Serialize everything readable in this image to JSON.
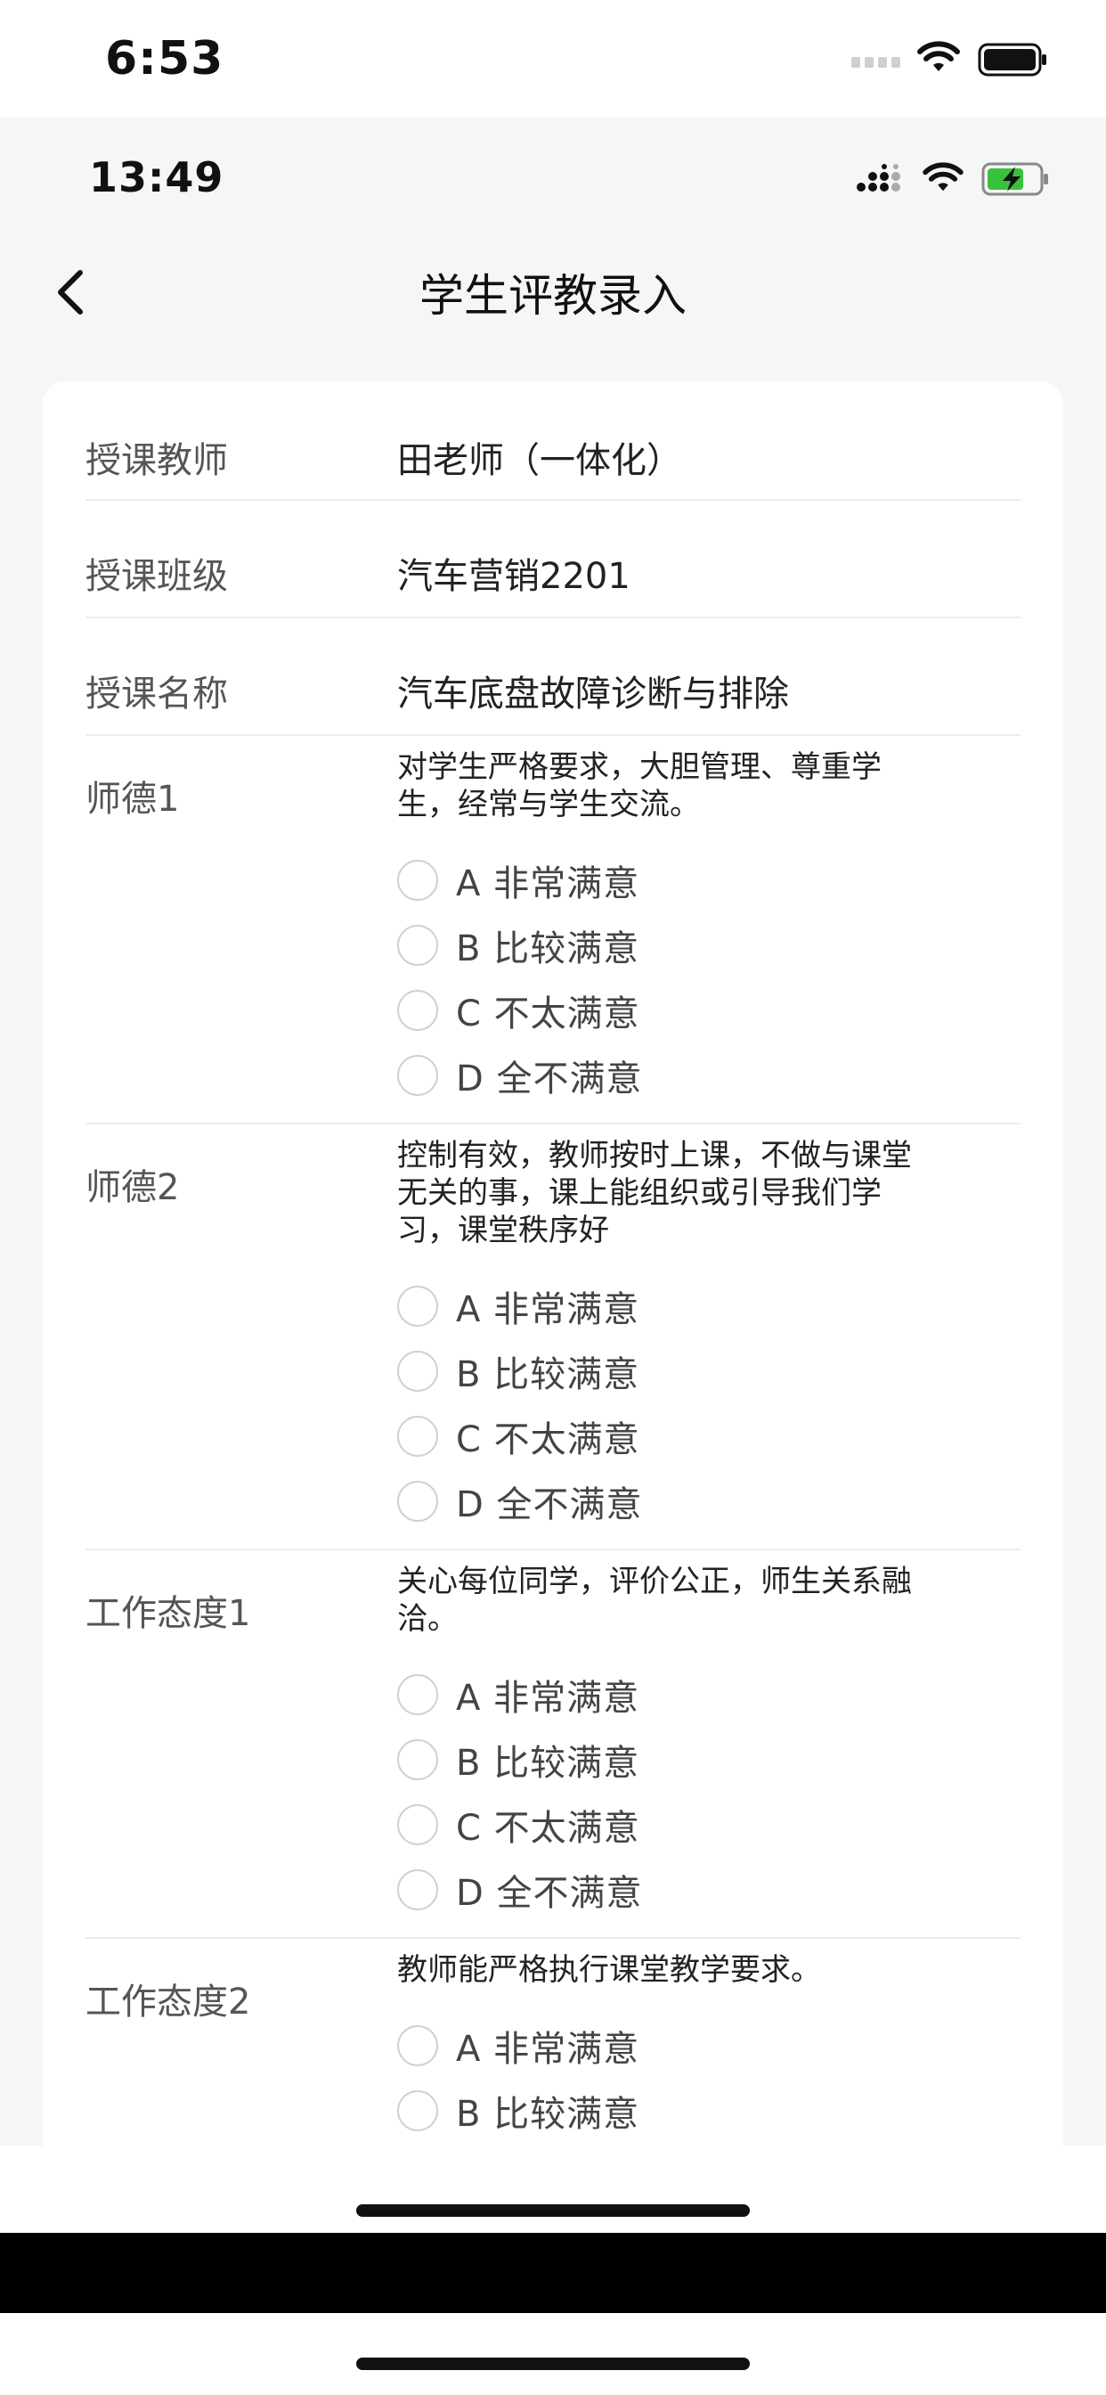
{
  "outer_status": {
    "time": "6:53"
  },
  "inner_status": {
    "time": "13:49"
  },
  "nav": {
    "title": "学生评教录入"
  },
  "info": [
    {
      "label": "授课教师",
      "value": "田老师（一体化）"
    },
    {
      "label": "授课班级",
      "value": "汽车营销2201"
    },
    {
      "label": "授课名称",
      "value": "汽车底盘故障诊断与排除"
    }
  ],
  "questions": [
    {
      "label": "师德1",
      "text_lines": [
        "对学生严格要求，大胆管理、尊重学",
        "生，经常与学生交流。"
      ],
      "options": [
        "A 非常满意",
        "B 比较满意",
        "C 不太满意",
        "D 全不满意"
      ]
    },
    {
      "label": "师德2",
      "text_lines": [
        "控制有效，教师按时上课，不做与课堂",
        "无关的事，课上能组织或引导我们学",
        "习，课堂秩序好"
      ],
      "options": [
        "A 非常满意",
        "B 比较满意",
        "C 不太满意",
        "D 全不满意"
      ]
    },
    {
      "label": "工作态度1",
      "text_lines": [
        "关心每位同学，评价公正，师生关系融",
        "洽。"
      ],
      "options": [
        "A 非常满意",
        "B 比较满意",
        "C 不太满意",
        "D 全不满意"
      ]
    },
    {
      "label": "工作态度2",
      "text_lines": [
        "教师能严格执行课堂教学要求。"
      ],
      "options": [
        "A 非常满意",
        "B 比较满意"
      ]
    }
  ]
}
